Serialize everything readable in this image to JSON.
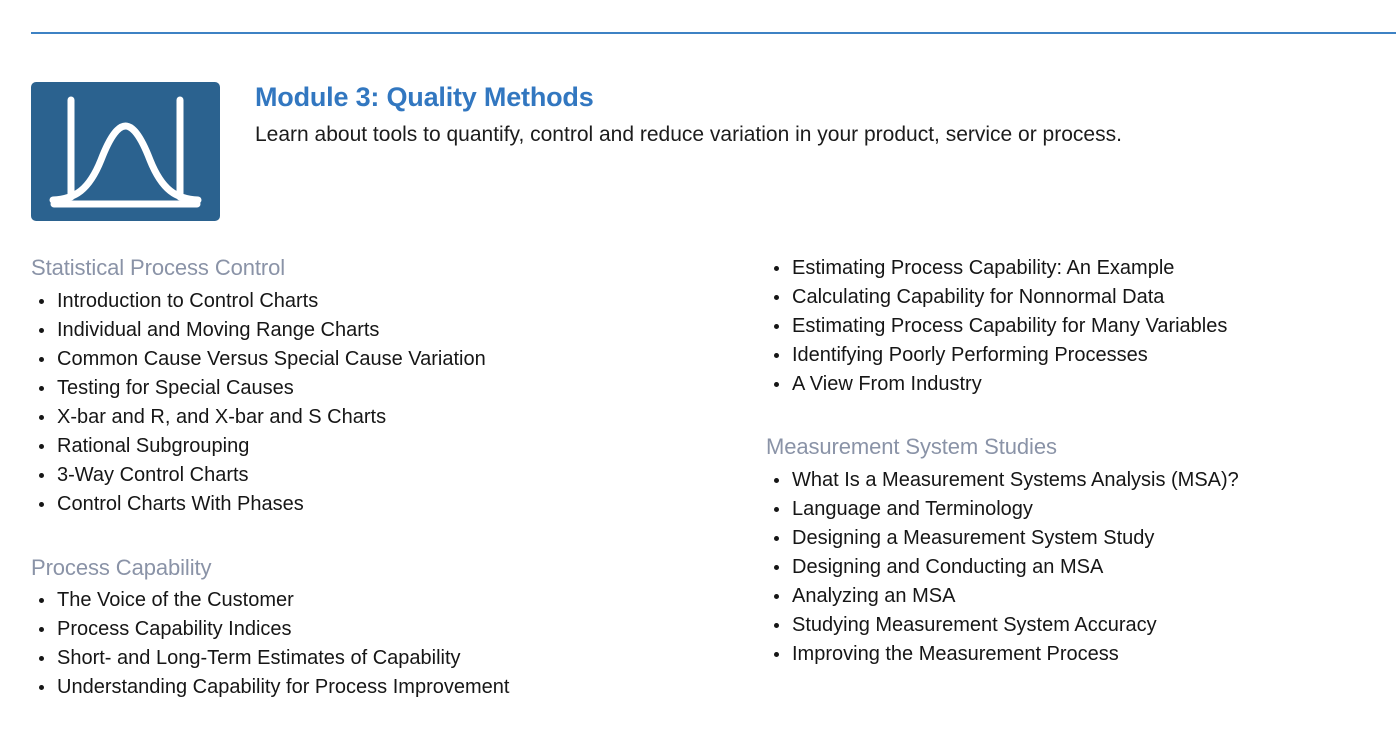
{
  "theme": {
    "rule_color": "#3d82c4",
    "title_color": "#3277c0",
    "heading_color": "#8a93a7",
    "icon_bg": "#2b628f",
    "icon_stroke": "#ffffff",
    "body_color": "#161616",
    "page_bg": "#ffffff"
  },
  "header": {
    "icon_name": "normal-distribution-curve-icon",
    "title": "Module 3: Quality Methods",
    "subtitle": "Learn about tools to quantify, control and reduce variation in your product, service or process."
  },
  "columns": {
    "left": [
      {
        "heading": "Statistical Process Control",
        "items": [
          "Introduction to Control Charts",
          "Individual and Moving Range Charts",
          "Common Cause Versus Special Cause Variation",
          "Testing for Special Causes",
          "X-bar and R, and X-bar and S Charts",
          "Rational Subgrouping",
          "3-Way Control Charts",
          "Control Charts With Phases"
        ]
      },
      {
        "heading": "Process Capability",
        "items": [
          "The Voice of the Customer",
          "Process Capability Indices",
          "Short- and Long-Term Estimates of Capability",
          "Understanding Capability for Process Improvement"
        ]
      }
    ],
    "right": [
      {
        "heading": "",
        "items": [
          "Estimating Process Capability: An Example",
          "Calculating Capability for Nonnormal Data",
          "Estimating Process Capability for Many Variables",
          "Identifying Poorly Performing Processes",
          "A View From Industry"
        ]
      },
      {
        "heading": "Measurement System Studies",
        "items": [
          "What Is a Measurement Systems Analysis (MSA)?",
          "Language and Terminology",
          "Designing a Measurement System Study",
          "Designing and Conducting an MSA",
          "Analyzing an MSA",
          "Studying Measurement System Accuracy",
          "Improving the Measurement Process"
        ]
      }
    ]
  }
}
